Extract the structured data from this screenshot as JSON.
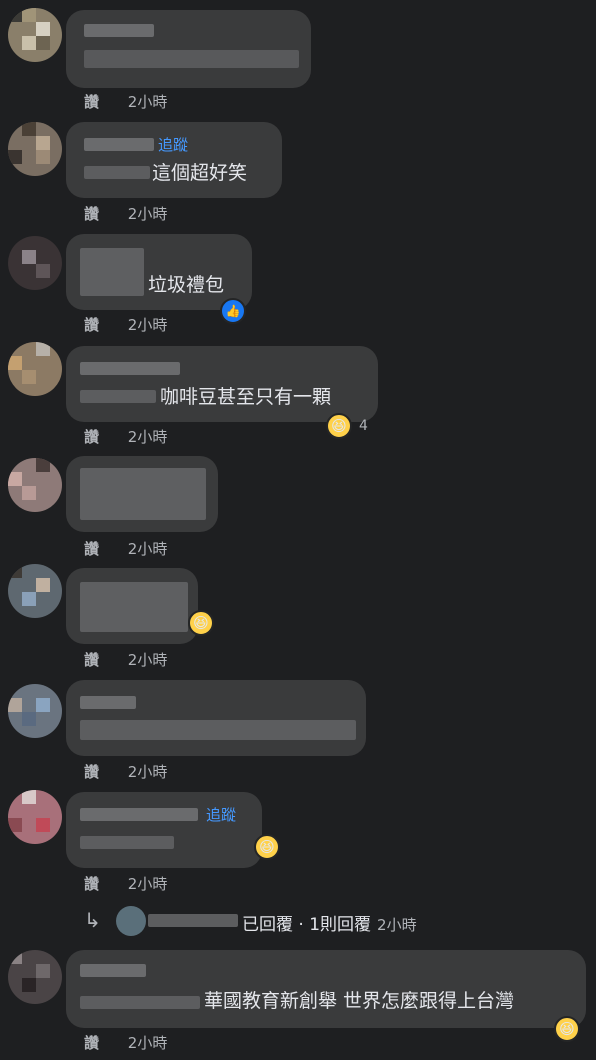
{
  "comments": [
    {
      "text": "",
      "follow": "",
      "time": "2小時",
      "like": "讚",
      "reaction": ""
    },
    {
      "text": "這個超好笑",
      "follow": "追蹤",
      "time": "2小時",
      "like": "讚",
      "reaction": ""
    },
    {
      "text": "垃圾禮包",
      "follow": "",
      "time": "2小時",
      "like": "讚",
      "reaction": "like-icon"
    },
    {
      "text": "咖啡豆甚至只有一顆",
      "follow": "",
      "time": "2小時",
      "like": "讚",
      "reaction": "haha-icon",
      "reaction_count": "4"
    },
    {
      "text": "",
      "follow": "",
      "time": "2小時",
      "like": "讚",
      "reaction": ""
    },
    {
      "text": "",
      "follow": "",
      "time": "2小時",
      "like": "讚",
      "reaction": "haha-icon"
    },
    {
      "text": "",
      "follow": "",
      "time": "2小時",
      "like": "讚",
      "reaction": ""
    },
    {
      "text": "",
      "follow": "追蹤",
      "time": "2小時",
      "like": "讚",
      "reaction": "haha-icon"
    },
    {
      "text": "華國教育新創舉 世界怎麼跟得上台灣",
      "follow": "",
      "time": "2小時",
      "like": "讚",
      "reaction": "haha-icon"
    }
  ],
  "reply_summary": {
    "text": "已回覆 · 1則回覆",
    "time": "2小時",
    "arrow_icon": "reply-arrow-icon"
  },
  "colors": {
    "background": "#1e1f21",
    "bubble": "#3a3b3c",
    "follow": "#4599ff",
    "meta": "#b0b3b8"
  }
}
